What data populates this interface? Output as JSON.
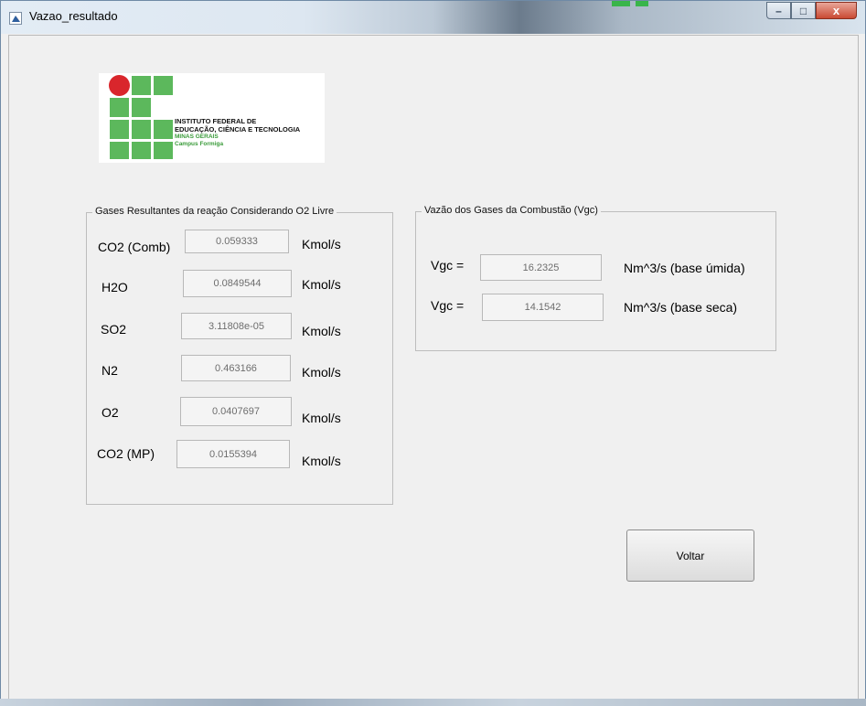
{
  "window": {
    "title": "Vazao_resultado",
    "controls": {
      "minimize": "–",
      "maximize": "□",
      "close": "x"
    }
  },
  "logo": {
    "line1": "INSTITUTO FEDERAL DE",
    "line2": "EDUCAÇÃO, CIÊNCIA E TECNOLOGIA",
    "line3": "MINAS GERAIS",
    "line4": "Campus Formiga"
  },
  "gases_group": {
    "title": "Gases Resultantes da reação  Considerando O2 Livre",
    "rows": [
      {
        "label": "CO2 (Comb)",
        "value": "0.059333",
        "unit": "Kmol/s"
      },
      {
        "label": "H2O",
        "value": "0.0849544",
        "unit": "Kmol/s"
      },
      {
        "label": "SO2",
        "value": "3.11808e-05",
        "unit": "Kmol/s"
      },
      {
        "label": "N2",
        "value": "0.463166",
        "unit": "Kmol/s"
      },
      {
        "label": "O2",
        "value": "0.0407697",
        "unit": "Kmol/s"
      },
      {
        "label": "CO2 (MP)",
        "value": "0.0155394",
        "unit": "Kmol/s"
      }
    ]
  },
  "vgc_group": {
    "title": "Vazão dos Gases da Combustão (Vgc)",
    "rows": [
      {
        "label": "Vgc =",
        "value": "16.2325",
        "unit": "Nm^3/s (base úmida)"
      },
      {
        "label": "Vgc =",
        "value": "14.1542",
        "unit": "Nm^3/s (base seca)"
      }
    ]
  },
  "buttons": {
    "voltar": "Voltar"
  }
}
